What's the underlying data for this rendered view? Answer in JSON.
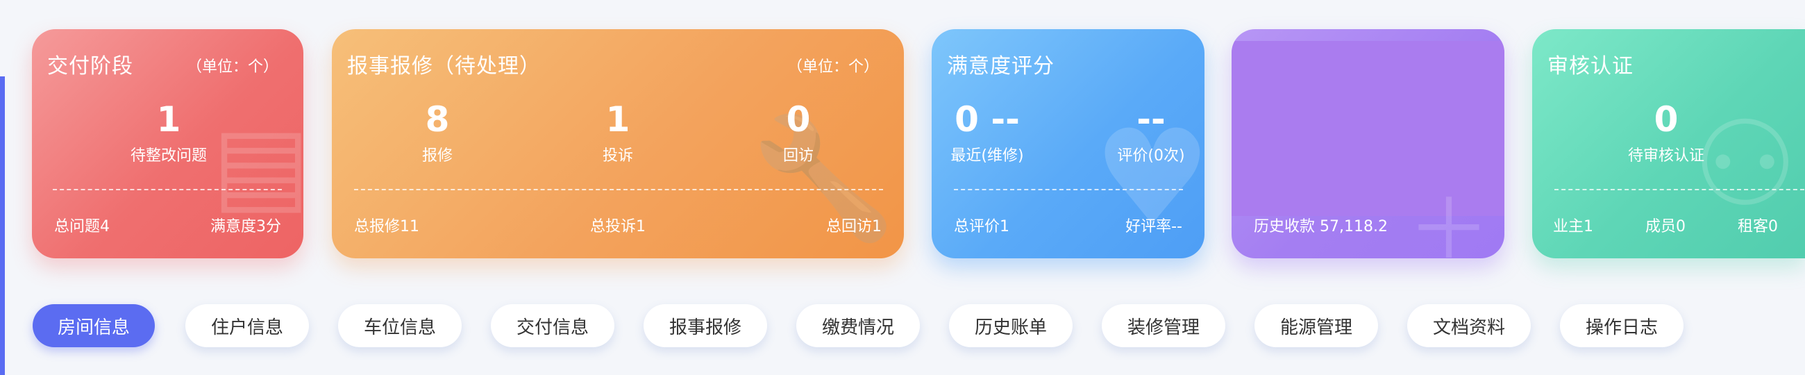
{
  "cards": {
    "delivery": {
      "title": "交付阶段",
      "unit": "（单位：个）",
      "metric_value": "1",
      "metric_label": "待整改问题",
      "footer_left": "总问题4",
      "footer_right": "满意度3分"
    },
    "repair": {
      "title": "报事报修（待处理）",
      "unit": "（单位：个）",
      "metrics": [
        {
          "value": "8",
          "label": "报修"
        },
        {
          "value": "1",
          "label": "投诉"
        },
        {
          "value": "0",
          "label": "回访"
        }
      ],
      "footer_left": "总报修11",
      "footer_middle": "总投诉1",
      "footer_right": "总回访1"
    },
    "satisfaction": {
      "title": "满意度评分",
      "metric_left_value": "0 --",
      "metric_left_label": "最近(维修)",
      "metric_right_value": "--",
      "metric_right_label": "评价(0次)",
      "footer_left": "总评价1",
      "footer_right": "好评率--"
    },
    "payment": {
      "footer": "历史收款 57,118.2"
    },
    "verify": {
      "title": "审核认证",
      "metric_value": "0",
      "metric_label": "待审核认证",
      "footer_owner": "业主1",
      "footer_member": "成员0",
      "footer_tenant": "租客0"
    }
  },
  "tabs": [
    {
      "label": "房间信息",
      "active": true
    },
    {
      "label": "住户信息"
    },
    {
      "label": "车位信息"
    },
    {
      "label": "交付信息"
    },
    {
      "label": "报事报修"
    },
    {
      "label": "缴费情况"
    },
    {
      "label": "历史账单"
    },
    {
      "label": "装修管理"
    },
    {
      "label": "能源管理"
    },
    {
      "label": "文档资料"
    },
    {
      "label": "操作日志"
    }
  ],
  "colors": {
    "red": "#ee6464",
    "orange": "#f29547",
    "blue": "#4e9ef5",
    "purple": "#a07af3",
    "green": "#52cdae",
    "accent": "#5b6cf1"
  }
}
